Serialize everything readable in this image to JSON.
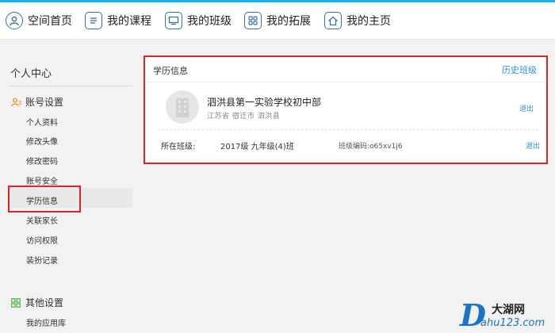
{
  "topnav": {
    "items": [
      {
        "label": "空间首页",
        "icon": "user-circle-icon"
      },
      {
        "label": "我的课程",
        "icon": "book-icon"
      },
      {
        "label": "我的班级",
        "icon": "monitor-icon"
      },
      {
        "label": "我的拓展",
        "icon": "grid-icon"
      },
      {
        "label": "我的主页",
        "icon": "home-icon"
      }
    ]
  },
  "sidebar": {
    "title": "个人中心",
    "account_group": "账号设置",
    "account_items": [
      "个人资料",
      "修改头像",
      "修改密码",
      "账号安全",
      "学历信息",
      "关联家长",
      "访问权限",
      "装扮记录"
    ],
    "other_group": "其他设置",
    "other_items": [
      "我的应用库"
    ],
    "active_item": "学历信息"
  },
  "panel": {
    "title": "学历信息",
    "history_link": "历史班级",
    "school_name": "泗洪县第一实验学校初中部",
    "school_location": "江苏省 宿迁市 泗洪县",
    "exit_label": "退出",
    "class_label": "所在班级:",
    "class_name": "2017级 九年级(4)班",
    "class_code": "班级编码:o65xv1j6",
    "class_exit_label": "退出"
  },
  "watermark": {
    "letter": "D",
    "top": "大湖网",
    "bottom": "ahu123.com"
  },
  "colors": {
    "accent": "#2f8ddc",
    "highlight": "#e0232b",
    "nav_icon": "#3a6fa5",
    "top_stripe": "#19b4e6"
  }
}
